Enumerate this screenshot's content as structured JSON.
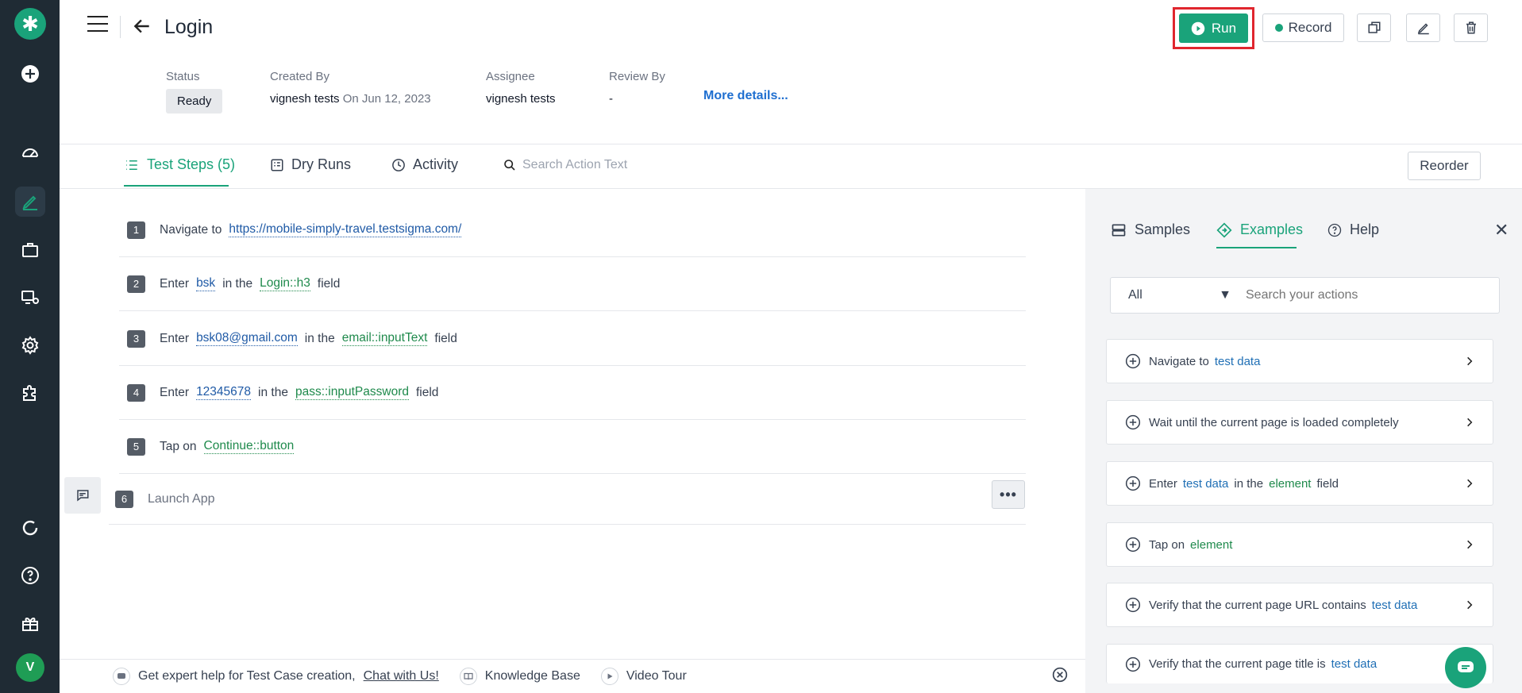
{
  "header": {
    "title": "Login",
    "buttons": {
      "run": "Run",
      "record": "Record"
    }
  },
  "meta": {
    "status_label": "Status",
    "status_value": "Ready",
    "created_by_label": "Created By",
    "created_by_value": "vignesh tests",
    "created_on": "On Jun 12, 2023",
    "assignee_label": "Assignee",
    "assignee_value": "vignesh tests",
    "review_by_label": "Review By",
    "review_by_value": "-",
    "more_details": "More details..."
  },
  "tabs": {
    "test_steps": "Test Steps (5)",
    "dry_runs": "Dry Runs",
    "activity": "Activity",
    "search_placeholder": "Search Action Text",
    "reorder": "Reorder"
  },
  "steps": [
    {
      "num": "1",
      "parts": [
        "Navigate to",
        "https://mobile-simply-travel.testsigma.com/"
      ]
    },
    {
      "num": "2",
      "parts": [
        "Enter",
        "bsk",
        "in the",
        "Login::h3",
        "field"
      ]
    },
    {
      "num": "3",
      "parts": [
        "Enter",
        "bsk08@gmail.com",
        "in the",
        "email::inputText",
        "field"
      ]
    },
    {
      "num": "4",
      "parts": [
        "Enter",
        "12345678",
        "in the",
        "pass::inputPassword",
        "field"
      ]
    },
    {
      "num": "5",
      "parts": [
        "Tap on",
        "Continue::button"
      ]
    }
  ],
  "new_step": {
    "num": "6",
    "text": "Launch App"
  },
  "panel": {
    "tabs": {
      "samples": "Samples",
      "examples": "Examples",
      "help": "Help"
    },
    "filter_value": "All",
    "search_placeholder": "Search your actions",
    "cards": [
      {
        "a": "Navigate to",
        "b": "test data"
      },
      {
        "a": "Wait until the current page is loaded completely"
      },
      {
        "a": "Enter",
        "b": "test data",
        "c": "in the",
        "d": "element",
        "e": "field"
      },
      {
        "a": "Tap on",
        "b": "element"
      },
      {
        "a": "Verify that the current page URL contains",
        "b": "test data"
      },
      {
        "a": "Verify that the current page title is",
        "b": "test data"
      }
    ]
  },
  "footer": {
    "help_text": "Get expert help for Test Case creation,",
    "chat_link": "Chat with Us!",
    "knowledge_base": "Knowledge Base",
    "video_tour": "Video Tour"
  },
  "user": {
    "avatar_initial": "V"
  },
  "colors": {
    "accent": "#1aa37a",
    "rail": "#1f2b34",
    "highlight": "#e0262e",
    "link": "#1f6fd0"
  }
}
